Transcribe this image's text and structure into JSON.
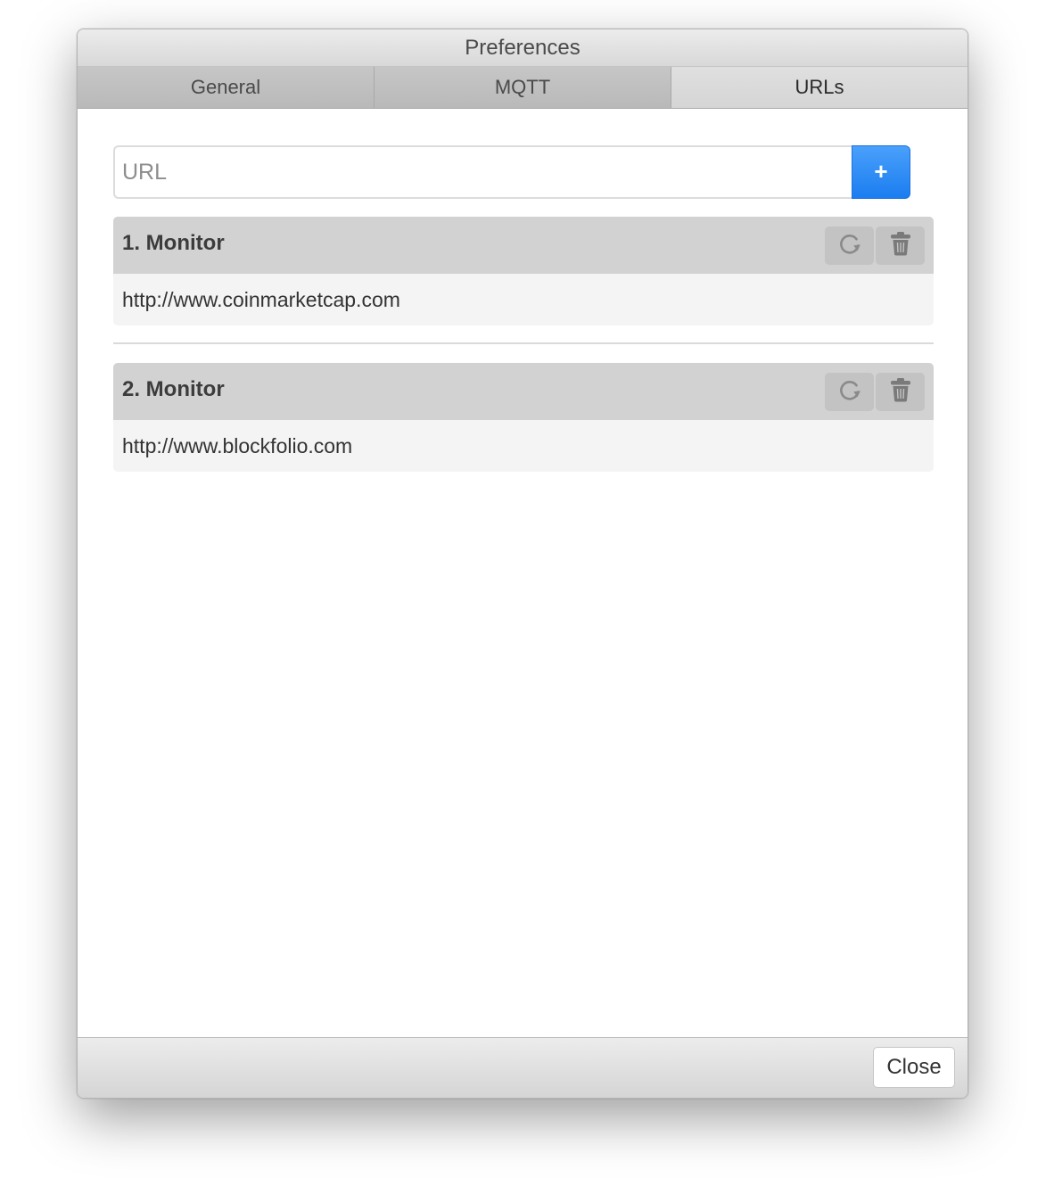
{
  "window": {
    "title": "Preferences"
  },
  "tabs": [
    {
      "label": "General",
      "active": false
    },
    {
      "label": "MQTT",
      "active": false
    },
    {
      "label": "URLs",
      "active": true
    }
  ],
  "url_form": {
    "placeholder": "URL",
    "value": "",
    "add_label": "+"
  },
  "monitors": [
    {
      "title": "1. Monitor",
      "url": "http://www.coinmarketcap.com",
      "actions": {
        "refresh_icon": "refresh-icon",
        "delete_icon": "trash-icon"
      }
    },
    {
      "title": "2. Monitor",
      "url": "http://www.blockfolio.com",
      "actions": {
        "refresh_icon": "refresh-icon",
        "delete_icon": "trash-icon"
      }
    }
  ],
  "footer": {
    "close_label": "Close"
  },
  "colors": {
    "accent": "#1b7df0",
    "monitor_header": "#d2d2d2",
    "monitor_body": "#f4f4f4"
  }
}
